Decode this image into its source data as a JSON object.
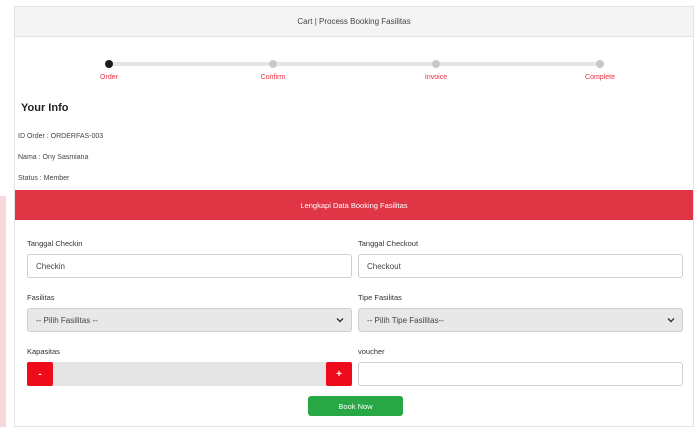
{
  "header": {
    "title": "Cart | Process Booking Fasilitas"
  },
  "stepper": {
    "steps": [
      {
        "label": "Order",
        "active": true
      },
      {
        "label": "Confirm",
        "active": false
      },
      {
        "label": "Invoice",
        "active": false
      },
      {
        "label": "Complete",
        "active": false
      }
    ]
  },
  "info": {
    "title": "Your Info",
    "order_id": "ID Order : ORDERFAS-003",
    "name": "Nama : Ony Sasmiana",
    "status": "Status : Member"
  },
  "banner": {
    "text": "Lengkapi Data Booking Fasilitas"
  },
  "form": {
    "checkin_label": "Tanggal Checkin",
    "checkin_value": "Checkin",
    "checkout_label": "Tanggal Checkout",
    "checkout_value": "Checkout",
    "fasilitas_label": "Fasilitas",
    "fasilitas_value": "-- Pilih Fasilitas --",
    "tipe_label": "Tipe Fasilitas",
    "tipe_value": "-- Pilih Tipe Fasilitas--",
    "kapasitas_label": "Kapasitas",
    "minus": "-",
    "plus": "+",
    "voucher_label": "voucher",
    "voucher_value": "",
    "book_button": "Book Now"
  },
  "colors": {
    "accent_red": "#df3545",
    "button_red": "#ee0c1c",
    "button_green": "#27a844"
  }
}
